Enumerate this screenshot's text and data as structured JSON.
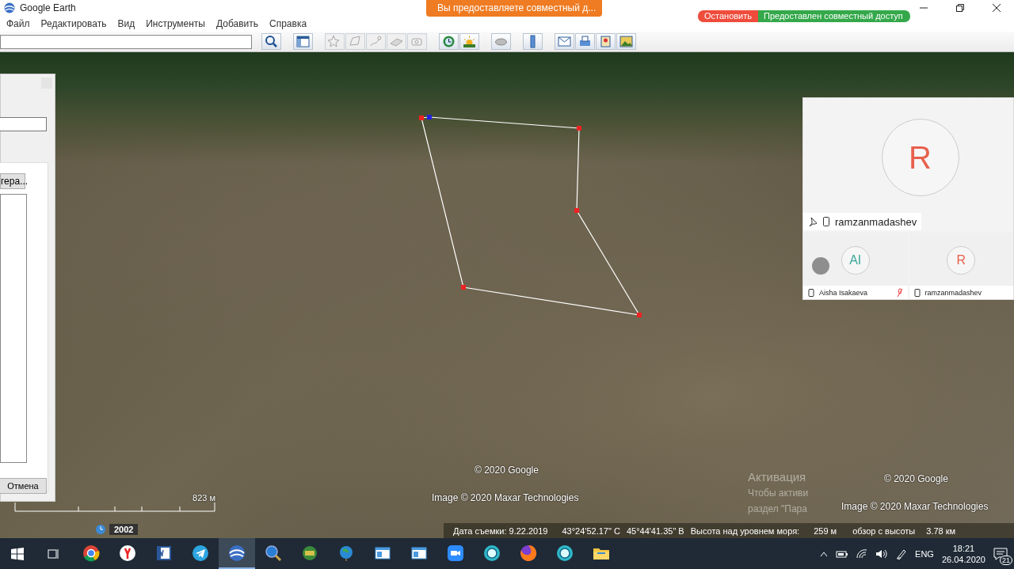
{
  "window": {
    "title": "Google Earth"
  },
  "share_banner": {
    "text": "Вы предоставляете совместный д..."
  },
  "share_bar": {
    "stop": "Остановить",
    "status": "Предоставлен совместный доступ"
  },
  "menu": [
    "Файл",
    "Редактировать",
    "Вид",
    "Инструменты",
    "Добавить",
    "Справка"
  ],
  "toolbar": {
    "buttons": [
      {
        "kind": "search",
        "disabled": false
      },
      {
        "kind": "sidebar",
        "disabled": false
      },
      {
        "kind": "placemark",
        "disabled": true
      },
      {
        "kind": "polygon",
        "disabled": true
      },
      {
        "kind": "path",
        "disabled": true
      },
      {
        "kind": "overlay",
        "disabled": true
      },
      {
        "kind": "tour",
        "disabled": true
      },
      {
        "kind": "history",
        "disabled": false
      },
      {
        "kind": "sun",
        "disabled": false
      },
      {
        "kind": "planet",
        "disabled": false
      },
      {
        "kind": "ruler",
        "disabled": false
      },
      {
        "kind": "email",
        "disabled": false
      },
      {
        "kind": "print",
        "disabled": false
      },
      {
        "kind": "maps",
        "disabled": false
      },
      {
        "kind": "image",
        "disabled": false
      }
    ]
  },
  "dialog": {
    "browse_button": "гера...",
    "cancel_button": "Отмена"
  },
  "map": {
    "copyright": [
      "© 2020 Google",
      "Image © 2020 Maxar Technologies"
    ],
    "scale": "823 м",
    "year": "2002",
    "watermark": [
      "Активация",
      "Чтобы активи",
      "раздел \"Пара"
    ],
    "copyright_second": [
      "© 2020 Google",
      "Image © 2020 Maxar Technologies"
    ],
    "status": {
      "date": "Дата съемки: 9.22.2019",
      "latitude": "43°24'52.17\" С",
      "longitude": "45°44'41.35\" В",
      "elevation_label": "Высота над уровнем моря:",
      "elevation": "259 м",
      "eye_label": "обзор с высоты",
      "eye": "3.78 км"
    }
  },
  "video_panel": {
    "main": {
      "initials": "R",
      "name": "ramzanmadashev",
      "color": "#e8604c"
    },
    "tiles": [
      {
        "initials": "AI",
        "name": "Aisha Isakaeva",
        "color": "#3aa89a",
        "muted": true
      },
      {
        "initials": "R",
        "name": "ramzanmadashev",
        "color": "#e8604c",
        "muted": false
      }
    ]
  },
  "taskbar": {
    "apps": [
      {
        "kind": "chrome",
        "running": false,
        "selected": false
      },
      {
        "kind": "yandex",
        "running": false,
        "selected": false
      },
      {
        "kind": "word",
        "running": false,
        "selected": false
      },
      {
        "kind": "telegram",
        "running": false,
        "selected": false
      },
      {
        "kind": "earth",
        "running": true,
        "selected": true
      },
      {
        "kind": "globe-search",
        "running": false,
        "selected": false
      },
      {
        "kind": "globe-green",
        "running": false,
        "selected": false
      },
      {
        "kind": "globe-pin",
        "running": false,
        "selected": false
      },
      {
        "kind": "window",
        "running": false,
        "selected": false
      },
      {
        "kind": "window",
        "running": false,
        "selected": false
      },
      {
        "kind": "zoom",
        "running": false,
        "selected": false
      },
      {
        "kind": "sphere",
        "running": false,
        "selected": false
      },
      {
        "kind": "firefox",
        "running": false,
        "selected": false
      },
      {
        "kind": "sphere",
        "running": false,
        "selected": false
      },
      {
        "kind": "folder",
        "running": false,
        "selected": false
      }
    ],
    "language": "ENG",
    "time": "18:21",
    "date": "26.04.2020",
    "notifications": "21"
  }
}
